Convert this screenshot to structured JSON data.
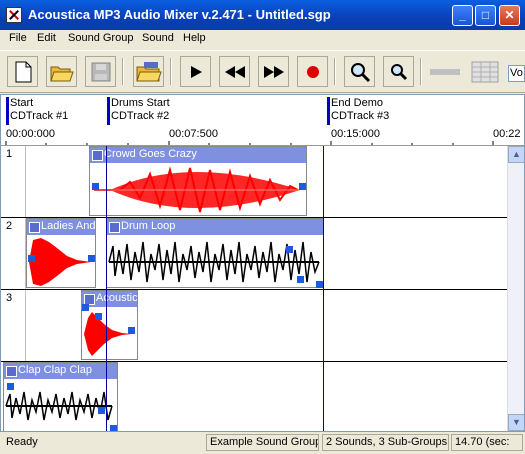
{
  "window": {
    "title": "Acoustica MP3 Audio Mixer v.2.471 - Untitled.sgp"
  },
  "menu": [
    "File",
    "Edit",
    "Sound Group",
    "Sound",
    "Help"
  ],
  "toolbar": {
    "zoom_field": "Vo"
  },
  "markers": [
    {
      "name": "Start",
      "track": "CDTrack #1"
    },
    {
      "name": "Drums Start",
      "track": "CDTrack #2"
    },
    {
      "name": "End Demo",
      "track": "CDTrack #3"
    }
  ],
  "timeline": [
    "00:00:000",
    "00:07:500",
    "00:15:000",
    "00:22"
  ],
  "tracks": [
    {
      "number": "1",
      "clips": [
        {
          "title": "Crowd Goes Crazy",
          "color": "#ff0000"
        }
      ]
    },
    {
      "number": "2",
      "clips": [
        {
          "title": "Ladies And",
          "color": "#ff0000"
        },
        {
          "title": "Drum Loop",
          "color": "#000000"
        }
      ]
    },
    {
      "number": "3",
      "clips": [
        {
          "title": "Acoustic",
          "color": "#ff0000"
        }
      ]
    },
    {
      "number": "",
      "clips": [
        {
          "title": "Clap Clap Clap",
          "color": "#000000"
        }
      ]
    }
  ],
  "status": {
    "state": "Ready",
    "group": "Example Sound Group",
    "counts": "2 Sounds, 3 Sub-Groups",
    "length": "14.70 (sec:"
  }
}
